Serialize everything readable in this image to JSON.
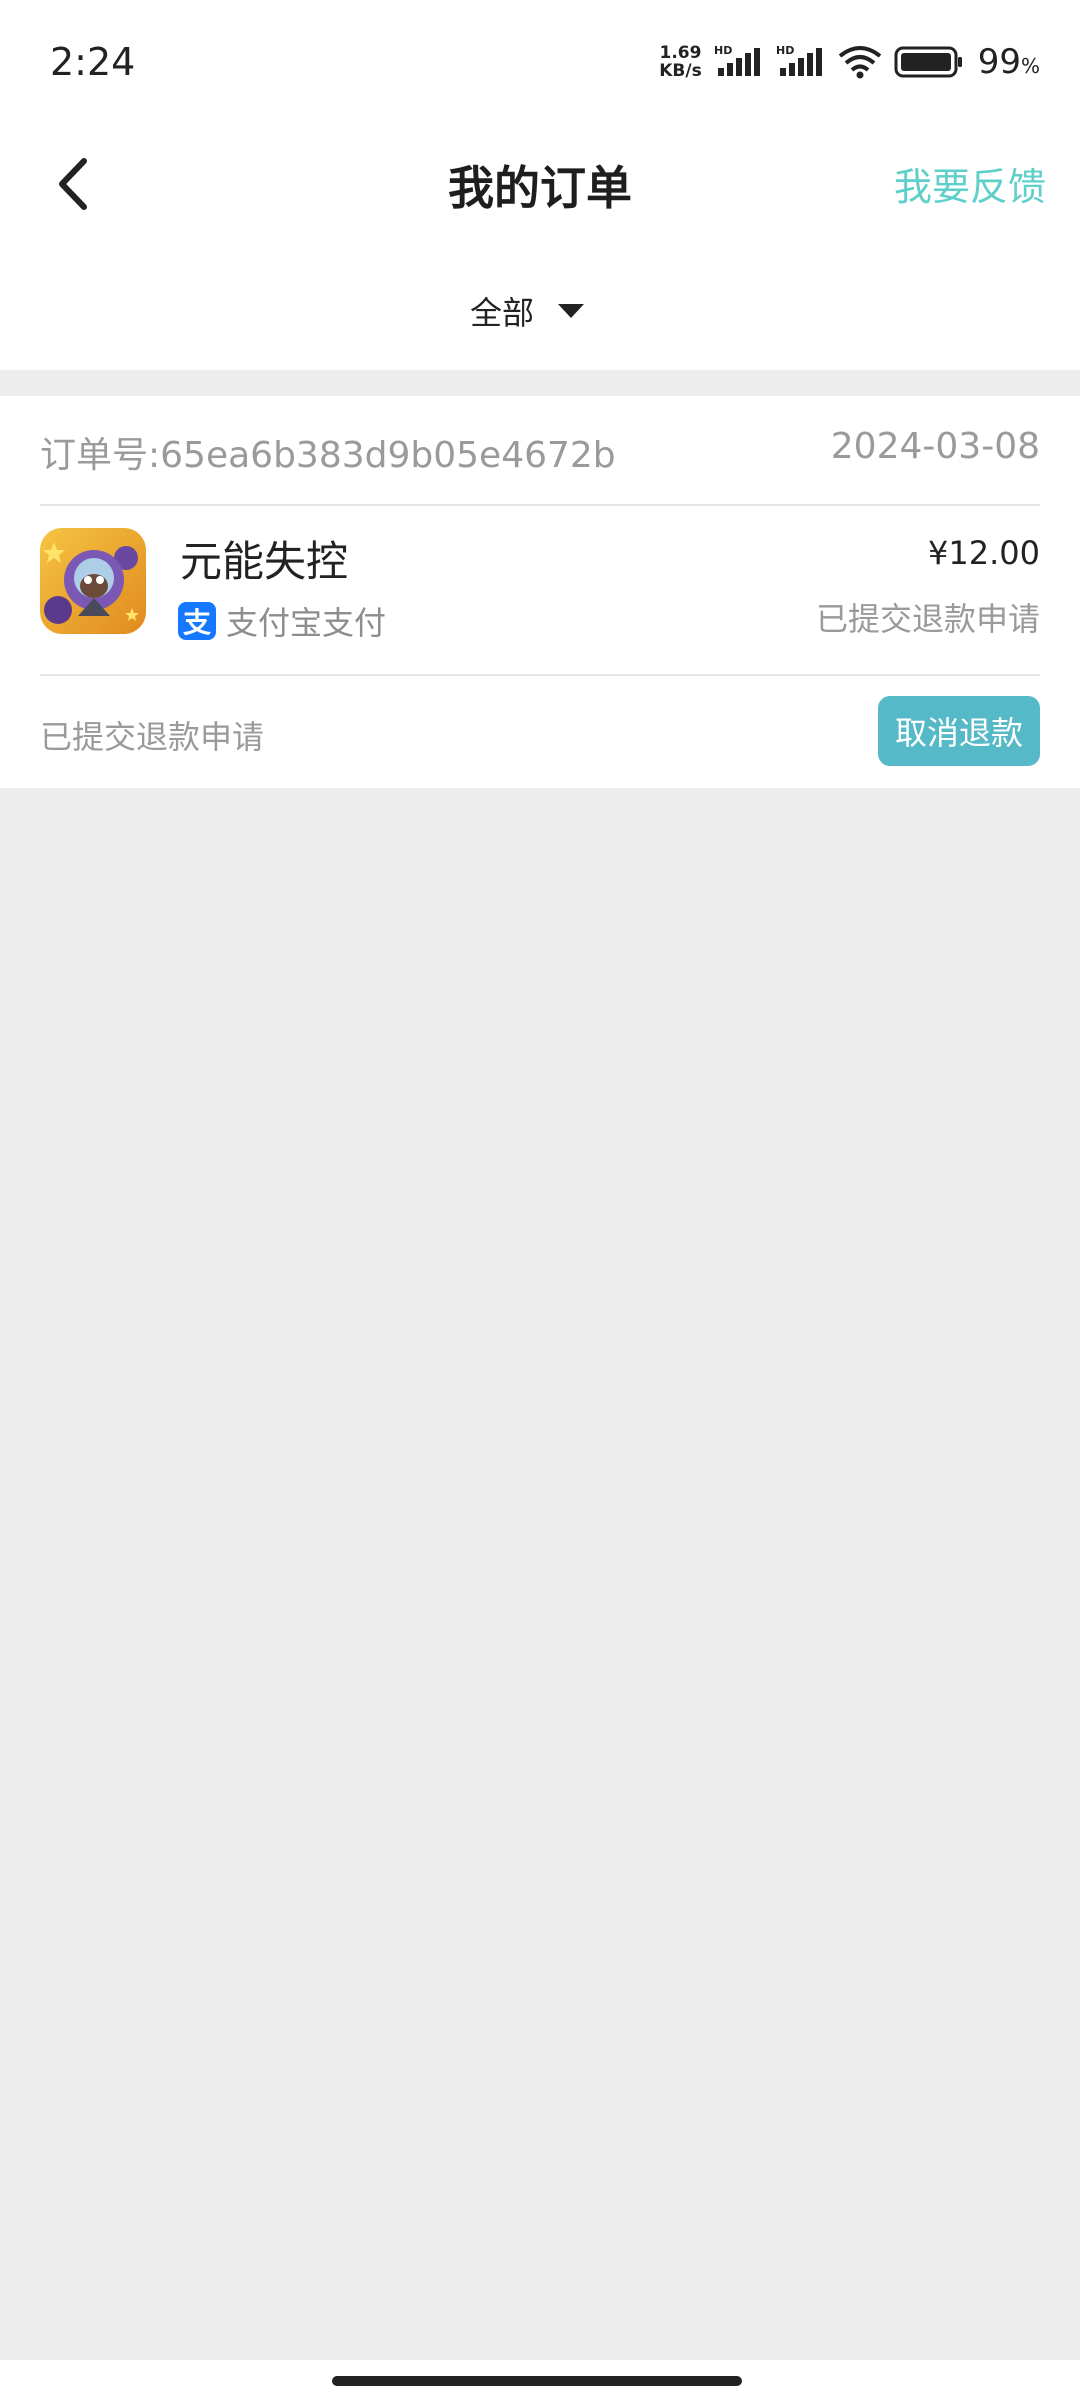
{
  "status_bar": {
    "time": "2:24",
    "net_speed_value": "1.69",
    "net_speed_unit": "KB/s",
    "signal_1_label": "HD",
    "signal_2_label": "HD",
    "battery_percent": "99",
    "battery_unit": "%",
    "icons": [
      "signal-icon",
      "signal-icon",
      "wifi-icon",
      "battery-icon"
    ]
  },
  "header": {
    "title": "我的订单",
    "feedback_label": "我要反馈",
    "back_icon": "chevron-left-icon",
    "accent_color": "#5fcfc9"
  },
  "filter": {
    "selected": "全部",
    "icon": "caret-down-icon"
  },
  "orders": [
    {
      "order_number_label": "订单号:",
      "order_number": "65ea6b383d9b05e4672b",
      "date": "2024-03-08",
      "product_name": "元能失控",
      "payment_method": "支付宝支付",
      "payment_icon_glyph": "支",
      "price": "¥12.00",
      "item_status": "已提交退款申请",
      "footer_status": "已提交退款申请",
      "action_label": "取消退款",
      "action_color": "#56b9c8"
    }
  ]
}
